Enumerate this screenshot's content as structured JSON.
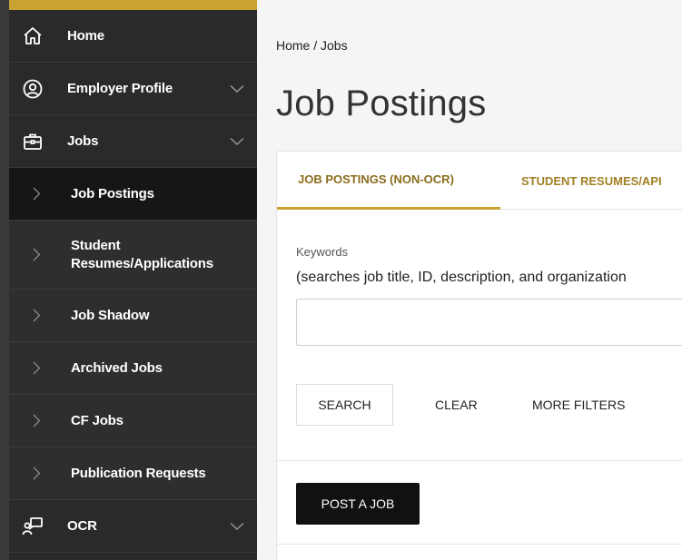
{
  "sidebar": {
    "items": [
      {
        "label": "Home",
        "icon": "home-icon"
      },
      {
        "label": "Employer Profile",
        "icon": "person-circle-icon"
      },
      {
        "label": "Jobs",
        "icon": "briefcase-icon"
      }
    ],
    "jobs_submenu": [
      {
        "label": "Job Postings",
        "active": true
      },
      {
        "label": "Student Resumes/Applications"
      },
      {
        "label": "Job Shadow"
      },
      {
        "label": "Archived Jobs"
      },
      {
        "label": "CF Jobs"
      },
      {
        "label": "Publication Requests"
      }
    ],
    "ocr": {
      "label": "OCR",
      "icon": "presenter-icon"
    }
  },
  "breadcrumb": "Home / Jobs",
  "page_title": "Job Postings",
  "tabs": [
    {
      "label": "JOB POSTINGS (NON-OCR)",
      "active": true
    },
    {
      "label": "STUDENT RESUMES/API"
    }
  ],
  "search": {
    "label": "Keywords",
    "hint": "(searches job title, ID, description, and organization",
    "value": "",
    "search_label": "SEARCH",
    "clear_label": "CLEAR",
    "more_filters_label": "MORE FILTERS"
  },
  "post_job_label": "POST A JOB",
  "colors": {
    "accent": "#c9a232",
    "sidebar_bg": "#2a2a2a",
    "active_bg": "#161616"
  }
}
